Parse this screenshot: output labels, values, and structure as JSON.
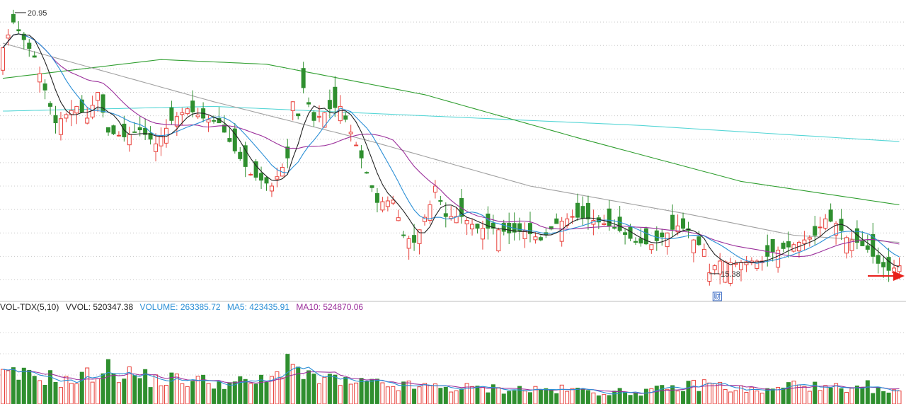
{
  "colors": {
    "up": "#e8413b",
    "down": "#2f8f2f",
    "ma_short": "#222222",
    "ma_mid": "#2b8fd6",
    "ma_long": "#9b2f9b",
    "ma_60": "#a0a0a0",
    "ma_120": "#2f9e2f",
    "ma_250": "#56d6d6",
    "vol_ma5": "#2b8fd6",
    "vol_ma10": "#9b2f9b",
    "arrow": "#e8201a",
    "grid": "#c8c8c8"
  },
  "chart_data": [
    {
      "type": "candlestick",
      "title": "",
      "ylim": [
        15.0,
        21.1
      ],
      "annotations": {
        "high_label": "20.95",
        "low_label": "15.38",
        "marker_glyph": "财"
      },
      "grid": "dotted-horizontal",
      "anchors": [
        [
          0,
          20.2
        ],
        [
          2,
          20.75
        ],
        [
          6,
          20.0
        ],
        [
          10,
          18.6
        ],
        [
          14,
          18.95
        ],
        [
          16,
          18.7
        ],
        [
          18,
          19.25
        ],
        [
          20,
          18.4
        ],
        [
          23,
          18.3
        ],
        [
          26,
          18.45
        ],
        [
          29,
          18.15
        ],
        [
          32,
          18.65
        ],
        [
          35,
          18.9
        ],
        [
          38,
          18.7
        ],
        [
          41,
          18.6
        ],
        [
          44,
          18.0
        ],
        [
          47,
          17.5
        ],
        [
          51,
          17.25
        ],
        [
          54,
          17.85
        ],
        [
          55,
          19.05
        ],
        [
          56,
          18.75
        ],
        [
          57,
          19.35
        ],
        [
          59,
          18.65
        ],
        [
          62,
          18.9
        ],
        [
          64,
          18.95
        ],
        [
          66,
          18.4
        ],
        [
          68,
          17.85
        ],
        [
          71,
          16.9
        ],
        [
          74,
          16.95
        ],
        [
          76,
          16.2
        ],
        [
          78,
          16.05
        ],
        [
          81,
          16.85
        ],
        [
          82,
          17.25
        ],
        [
          84,
          16.6
        ],
        [
          87,
          16.6
        ],
        [
          90,
          16.35
        ],
        [
          93,
          16.35
        ],
        [
          96,
          16.25
        ],
        [
          99,
          16.3
        ],
        [
          102,
          16.1
        ],
        [
          105,
          16.45
        ],
        [
          108,
          16.6
        ],
        [
          111,
          16.55
        ],
        [
          114,
          16.45
        ],
        [
          117,
          16.3
        ],
        [
          120,
          16.05
        ],
        [
          123,
          16.0
        ],
        [
          126,
          16.25
        ],
        [
          128,
          16.4
        ],
        [
          130,
          16.3
        ],
        [
          131,
          16.1
        ],
        [
          133,
          15.9
        ],
        [
          134,
          15.4
        ],
        [
          135,
          15.55
        ],
        [
          136,
          15.65
        ],
        [
          139,
          15.6
        ],
        [
          142,
          15.65
        ],
        [
          144,
          15.65
        ],
        [
          146,
          15.85
        ],
        [
          149,
          15.95
        ],
        [
          152,
          16.1
        ],
        [
          154,
          16.2
        ],
        [
          156,
          16.55
        ],
        [
          158,
          16.45
        ],
        [
          160,
          16.15
        ],
        [
          162,
          16.05
        ],
        [
          164,
          15.9
        ],
        [
          166,
          15.6
        ],
        [
          168,
          15.45
        ],
        [
          170,
          15.55
        ]
      ],
      "ma_lines": [
        {
          "name": "MA5",
          "period": 5
        },
        {
          "name": "MA10",
          "period": 10
        },
        {
          "name": "MA20",
          "period": 20
        },
        {
          "name": "MA60",
          "period": 60
        },
        {
          "name": "MA120",
          "period": 120
        },
        {
          "name": "MA250",
          "period": 250
        }
      ]
    },
    {
      "type": "bar",
      "title": "VOL-TDX(5,10)",
      "legend": {
        "name": "VOL-TDX(5,10)",
        "vvol": "VVOL: 520347.38",
        "volume": "VOLUME: 263385.72",
        "ma5": "MA5: 423435.91",
        "ma10": "MA10: 524870.06"
      },
      "ylim": [
        0,
        1800000
      ],
      "volume_peaks": [
        [
          8,
          640000
        ],
        [
          10,
          590000
        ],
        [
          12,
          520000
        ],
        [
          14,
          560000
        ],
        [
          19,
          820000
        ],
        [
          26,
          660000
        ],
        [
          28,
          570000
        ],
        [
          33,
          570000
        ],
        [
          37,
          550000
        ],
        [
          43,
          480000
        ],
        [
          51,
          540000
        ],
        [
          55,
          1250000
        ],
        [
          56,
          760000
        ],
        [
          58,
          580000
        ],
        [
          62,
          600000
        ],
        [
          65,
          470000
        ],
        [
          70,
          480000
        ],
        [
          72,
          430000
        ],
        [
          80,
          400000
        ],
        [
          86,
          380000
        ],
        [
          90,
          360000
        ],
        [
          97,
          350000
        ],
        [
          100,
          340000
        ],
        [
          107,
          330000
        ],
        [
          112,
          300000
        ],
        [
          116,
          270000
        ],
        [
          121,
          290000
        ],
        [
          126,
          340000
        ],
        [
          128,
          380000
        ],
        [
          131,
          430000
        ],
        [
          134,
          500000
        ],
        [
          137,
          390000
        ],
        [
          141,
          330000
        ],
        [
          144,
          300000
        ],
        [
          146,
          320000
        ],
        [
          148,
          390000
        ],
        [
          149,
          430000
        ],
        [
          152,
          520000
        ],
        [
          155,
          330000
        ],
        [
          158,
          380000
        ],
        [
          160,
          250000
        ],
        [
          162,
          320000
        ],
        [
          164,
          410000
        ],
        [
          166,
          310000
        ],
        [
          169,
          263385.72
        ]
      ]
    }
  ],
  "signal": {
    "kind": "right-arrow"
  }
}
